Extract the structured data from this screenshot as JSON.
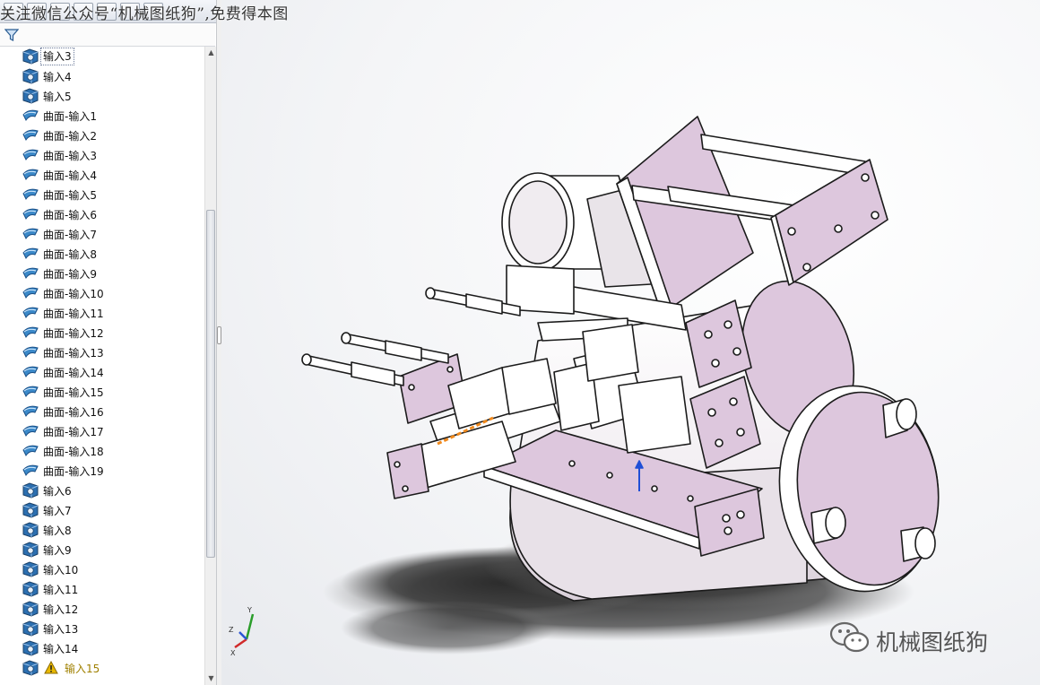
{
  "caption": "关注微信公众号“机械图纸狗”,免费得本图",
  "watermark": "机械图纸狗",
  "colors": {
    "part_fill": "#ddc7dd",
    "part_light": "#ffffff",
    "edge": "#1b1b1b",
    "tree_solid": "#2c6fb0",
    "tree_surface": "#3b89c9",
    "warning": "#e8b800"
  },
  "tree": [
    {
      "icon": "solid-body-icon",
      "label": "输入3",
      "selected": true
    },
    {
      "icon": "solid-body-icon",
      "label": "输入4"
    },
    {
      "icon": "solid-body-icon",
      "label": "输入5"
    },
    {
      "icon": "surface-body-icon",
      "label": "曲面-输入1"
    },
    {
      "icon": "surface-body-icon",
      "label": "曲面-输入2"
    },
    {
      "icon": "surface-body-icon",
      "label": "曲面-输入3"
    },
    {
      "icon": "surface-body-icon",
      "label": "曲面-输入4"
    },
    {
      "icon": "surface-body-icon",
      "label": "曲面-输入5"
    },
    {
      "icon": "surface-body-icon",
      "label": "曲面-输入6"
    },
    {
      "icon": "surface-body-icon",
      "label": "曲面-输入7"
    },
    {
      "icon": "surface-body-icon",
      "label": "曲面-输入8"
    },
    {
      "icon": "surface-body-icon",
      "label": "曲面-输入9"
    },
    {
      "icon": "surface-body-icon",
      "label": "曲面-输入10"
    },
    {
      "icon": "surface-body-icon",
      "label": "曲面-输入11"
    },
    {
      "icon": "surface-body-icon",
      "label": "曲面-输入12"
    },
    {
      "icon": "surface-body-icon",
      "label": "曲面-输入13"
    },
    {
      "icon": "surface-body-icon",
      "label": "曲面-输入14"
    },
    {
      "icon": "surface-body-icon",
      "label": "曲面-输入15"
    },
    {
      "icon": "surface-body-icon",
      "label": "曲面-输入16"
    },
    {
      "icon": "surface-body-icon",
      "label": "曲面-输入17"
    },
    {
      "icon": "surface-body-icon",
      "label": "曲面-输入18"
    },
    {
      "icon": "surface-body-icon",
      "label": "曲面-输入19"
    },
    {
      "icon": "solid-body-icon",
      "label": "输入6"
    },
    {
      "icon": "solid-body-icon",
      "label": "输入7"
    },
    {
      "icon": "solid-body-icon",
      "label": "输入8"
    },
    {
      "icon": "solid-body-icon",
      "label": "输入9"
    },
    {
      "icon": "solid-body-icon",
      "label": "输入10"
    },
    {
      "icon": "solid-body-icon",
      "label": "输入11"
    },
    {
      "icon": "solid-body-icon",
      "label": "输入12"
    },
    {
      "icon": "solid-body-icon",
      "label": "输入13"
    },
    {
      "icon": "solid-body-icon",
      "label": "输入14"
    },
    {
      "icon": "solid-body-icon",
      "label": "输入15",
      "warning": true
    }
  ],
  "triad": {
    "x": "X",
    "y": "Y",
    "z": "Z"
  }
}
